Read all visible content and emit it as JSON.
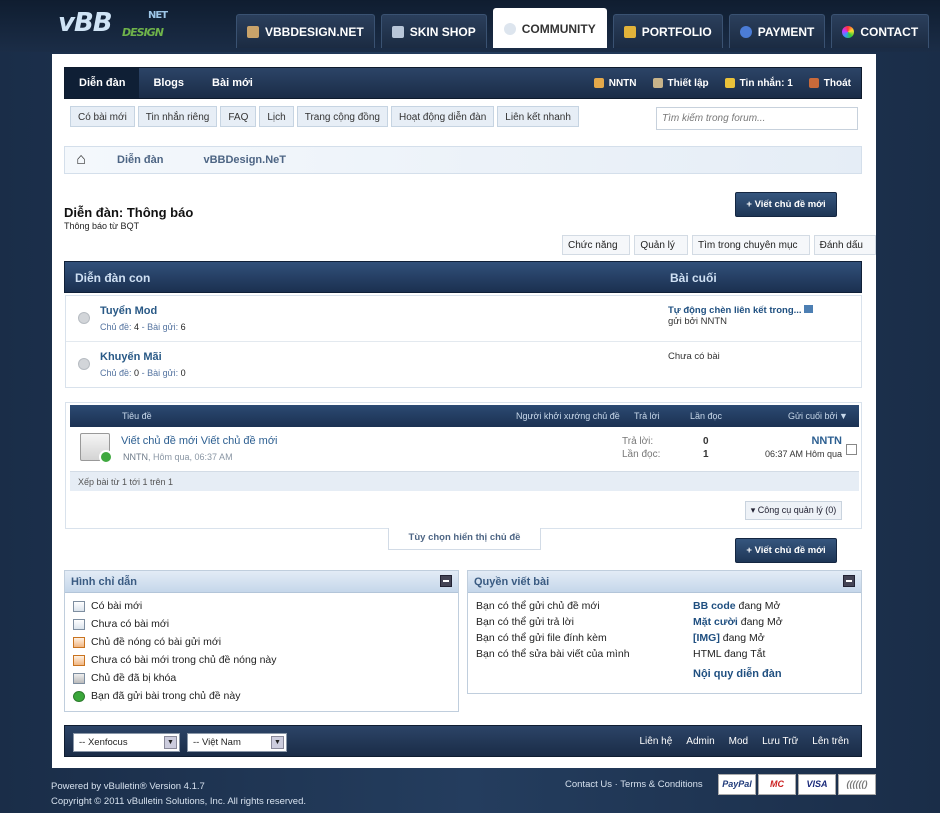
{
  "logo": {
    "main": "vBB",
    "sub": "DESIGN",
    "net": "NET"
  },
  "nav": [
    {
      "label": "VBBDESIGN.NET",
      "icon": "home-icon"
    },
    {
      "label": "SKIN SHOP",
      "icon": "shop-icon"
    },
    {
      "label": "COMMUNITY",
      "icon": "chat-icon"
    },
    {
      "label": "PORTFOLIO",
      "icon": "user-icon"
    },
    {
      "label": "PAYMENT",
      "icon": "help-icon"
    },
    {
      "label": "CONTACT",
      "icon": "color-wheel-icon"
    }
  ],
  "bar": {
    "tabs": [
      "Diễn đàn",
      "Blogs",
      "Bài mới"
    ],
    "user": "NNTN",
    "settings": "Thiết lập",
    "messages": "Tin nhắn: 1",
    "logout": "Thoát"
  },
  "subnav": [
    "Có bài mới",
    "Tin nhắn riêng",
    "FAQ",
    "Lịch",
    "Trang cộng đồng",
    "Hoạt động diễn đàn",
    "Liên kết nhanh"
  ],
  "search": {
    "placeholder": "Tìm kiếm trong forum..."
  },
  "breadcrumb": [
    "Diễn đàn",
    "vBBDesign.NeT"
  ],
  "forum": {
    "title": "Diễn đàn: Thông báo",
    "desc": "Thông báo từ BQT",
    "new_thread": "+ Viết chủ đề mới"
  },
  "tools": [
    "Chức năng",
    "Quản lý",
    "Tìm trong chuyên mục",
    "Đánh dấu"
  ],
  "subforums": {
    "header": "Diễn đàn con",
    "last": "Bài cuối",
    "rows": [
      {
        "name": "Tuyển Mod",
        "topics_label": "Chủ đề:",
        "topics": "4",
        "posts_label": "Bài gửi:",
        "posts": "6",
        "last_title": "Tự động chèn liên kết trong...",
        "last_by": "gửi bởi NNTN"
      },
      {
        "name": "Khuyến Mãi",
        "topics_label": "Chủ đề:",
        "topics": "0",
        "posts_label": "Bài gửi:",
        "posts": "0",
        "last_title": "Chưa có bài",
        "last_by": ""
      }
    ]
  },
  "threads": {
    "cols": {
      "title": "Tiêu đề",
      "starter": "Người khởi xướng chủ đề",
      "replies": "Trả lời",
      "views": "Lần đọc",
      "last": "Gửi cuối bởi"
    },
    "row": {
      "title": "Viết chủ đề mới Viết chủ đề mới",
      "author": "NNTN",
      "date": "Hôm qua, 06:37 AM",
      "replies_label": "Trả lời:",
      "replies": "0",
      "views_label": "Lần đọc:",
      "views": "1",
      "last_user": "NNTN",
      "last_time": "06:37 AM Hôm qua"
    },
    "footer": "Xếp bài từ 1 tới 1 trên 1",
    "mod_tools": "Công cụ quản lý (0)",
    "display_opts": "Tùy chọn hiển thị chủ đề"
  },
  "legend": {
    "title": "Hình chỉ dẫn",
    "items": [
      "Có bài mới",
      "Chưa có bài mới",
      "Chủ đề nóng có bài gửi mới",
      "Chưa có bài mới trong chủ đề nóng này",
      "Chủ đề đã bị khóa",
      "Bạn đã gửi bài trong chủ đề này"
    ]
  },
  "perms": {
    "title": "Quyền viết bài",
    "items": [
      "Bạn có thể gửi chủ đề mới",
      "Bạn có thể gửi trả lời",
      "Bạn có thể gửi file đính kèm",
      "Bạn có thể sửa bài viết của mình"
    ],
    "codes": [
      {
        "k": "BB code",
        "v": "đang Mở"
      },
      {
        "k": "Mặt cười",
        "v": "đang Mở"
      },
      {
        "k": "[IMG]",
        "v": "đang Mở"
      },
      {
        "k": "",
        "v": "HTML đang Tắt"
      }
    ],
    "rules": "Nội quy diễn đàn"
  },
  "footer": {
    "style": "-- Xenfocus",
    "lang": "-- Việt Nam",
    "links": [
      "Liên hệ",
      "Admin",
      "Mod",
      "Lưu Trữ",
      "Lên trên"
    ],
    "powered": "Powered by vBulletin® Version 4.1.7",
    "copyright": "Copyright © 2011 vBulletin Solutions, Inc. All rights reserved.",
    "contact": "Contact Us",
    "terms": "Terms & Conditions",
    "cards": [
      "PayPal",
      "MC",
      "VISA",
      "(((((()"
    ]
  }
}
